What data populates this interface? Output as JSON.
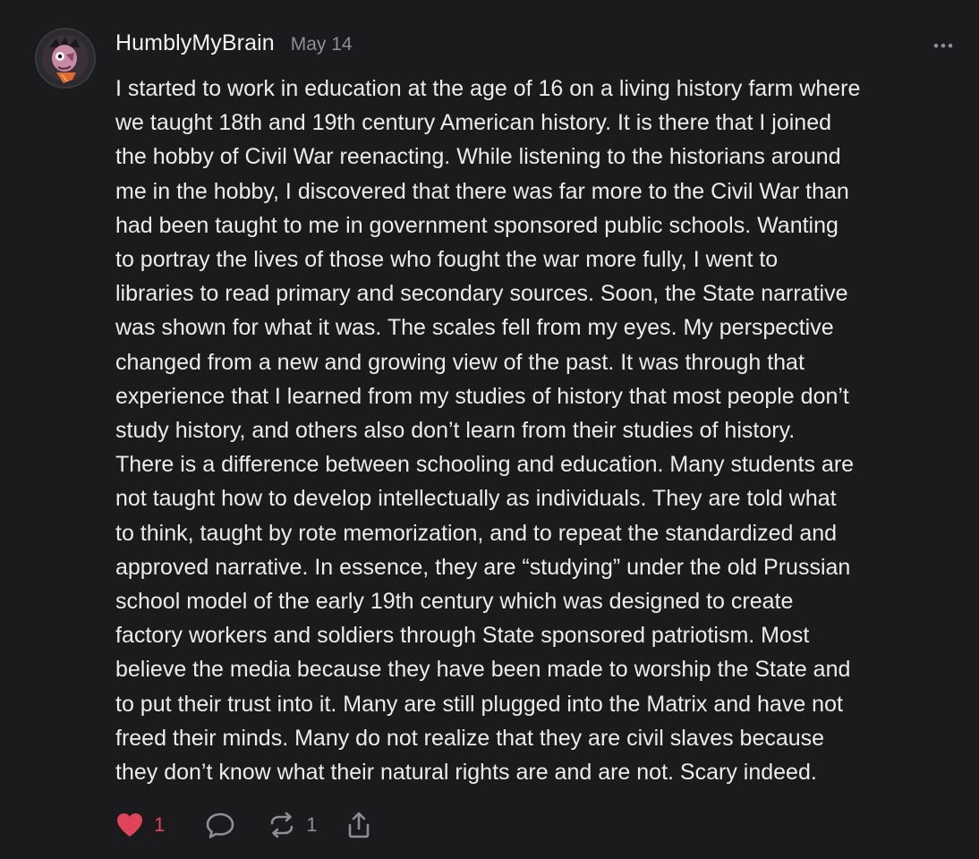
{
  "comment": {
    "author": "HumblyMyBrain",
    "date": "May 14",
    "lines": [
      "I started to work in education at the age of 16 on a living history farm where",
      "we taught 18th and 19th century American history. It is there that I joined",
      "the hobby of Civil War reenacting. While listening to the historians around",
      "me in the hobby, I discovered that there was far more to the Civil War than",
      "had been taught to me in government sponsored public schools. Wanting",
      "to portray the lives of those who fought the war more fully, I went to",
      "libraries to read primary and secondary sources. Soon, the State narrative",
      "was shown for what it was. The scales fell from my eyes. My perspective",
      "changed from a new and growing view of the past. It was through that",
      "experience that I learned from my studies of history that most people don’t",
      "study history, and others also don’t learn from their studies of history.",
      "There is a difference between schooling and education. Many students are",
      "not taught how to develop intellectually as individuals. They are told what",
      "to think, taught by rote memorization, and to repeat the standardized and",
      "approved narrative. In essence, they are “studying” under the old Prussian",
      "school model of the early 19th century which was designed to create",
      "factory workers and soldiers through State sponsored patriotism. Most",
      "believe the media because they have been made to worship the State and",
      "to put their trust into it. Many are still plugged into the Matrix and have not",
      "freed their minds. Many do not realize that they are civil slaves because",
      "they don’t know what their natural rights are and are not. Scary indeed."
    ]
  },
  "actions": {
    "like_count": "1",
    "restack_count": "1",
    "like_icon": "heart-filled-icon",
    "reply_icon": "speech-bubble-icon",
    "restack_icon": "restack-icon",
    "share_icon": "share-icon",
    "more_icon": "ellipsis-icon"
  },
  "colors": {
    "background": "#1b1b1d",
    "text": "#ececec",
    "muted": "#8e8e93",
    "like": "#e0445a"
  }
}
